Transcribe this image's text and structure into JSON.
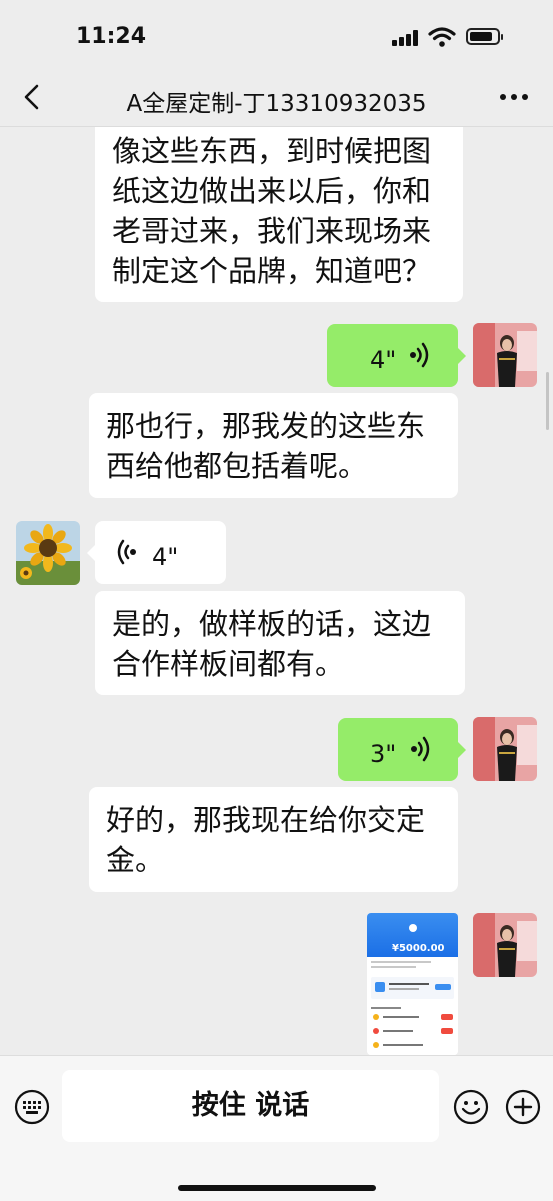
{
  "status_bar": {
    "time": "11:24",
    "battery_level": 0.85
  },
  "header": {
    "title": "A全屋定制-丁13310932035"
  },
  "messages": [
    {
      "side": "in",
      "type": "text",
      "text": "像这些东西，到时候把图\n纸这边做出来以后，你和\n老哥过来，我们来现场来\n制定这个品牌，知道吧？"
    },
    {
      "side": "out",
      "type": "voice",
      "duration": "4\""
    },
    {
      "side": "in",
      "type": "text",
      "text": "那也行，那我发的这些东\n西给他都包括着呢。"
    },
    {
      "side": "in",
      "type": "voice",
      "duration": "4\""
    },
    {
      "side": "in",
      "type": "text",
      "text": "是的，做样板的话，这边\n合作样板间都有。"
    },
    {
      "side": "out",
      "type": "voice",
      "duration": "3\""
    },
    {
      "side": "in",
      "type": "text",
      "text": "好的，那我现在给你交定\n金。"
    },
    {
      "side": "out",
      "type": "image",
      "amount": "¥5000.00"
    }
  ],
  "input_bar": {
    "hold_to_talk": "按住 说话"
  },
  "icons": [
    "back-icon",
    "more-icon",
    "voice-wave-icon",
    "keyboard-icon",
    "emoji-icon",
    "plus-icon",
    "signal-icon",
    "wifi-icon",
    "battery-icon"
  ],
  "colors": {
    "incoming_bubble": "#ffffff",
    "outgoing_bubble": "#95ec69",
    "background": "#ededed"
  }
}
